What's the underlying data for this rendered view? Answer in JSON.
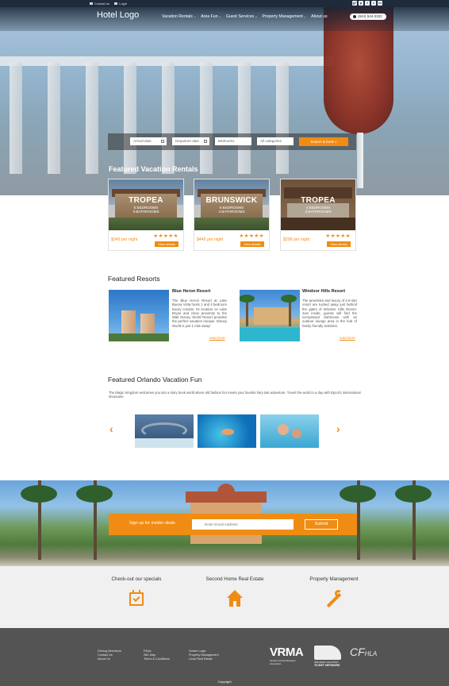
{
  "topbar": {
    "contact_label": "Contact us",
    "login_label": "Login",
    "social": [
      "g+",
      "p",
      "f",
      "t",
      "in"
    ]
  },
  "header": {
    "logo": "Hotel Logo",
    "menu": [
      "Vacation Rentals",
      "Area Fun",
      "Guest Services",
      "Property Management",
      "About us"
    ],
    "phone": "(844) 544-3322"
  },
  "search": {
    "arrival": "Arrival date",
    "departure": "Departure date",
    "bedrooms": "Bedrooms",
    "category": "All categories",
    "button": "Search & book"
  },
  "rentals": {
    "title": "Featured Vacation Rentals",
    "stars": "★★★★★",
    "view_label": "View details",
    "items": [
      {
        "name": "TROPEA",
        "beds": "5 BEDROOMS",
        "baths": "3 BATHROOMS",
        "price": "$349 per night"
      },
      {
        "name": "BRUNSWICK",
        "beds": "6 BEDROOMS",
        "baths": "4 BATHROOMS",
        "price": "$449 per night"
      },
      {
        "name": "TROPEA",
        "beds": "4 BEDROOMS",
        "baths": "3 BATHROOMS",
        "price": "$299 per night"
      }
    ]
  },
  "resorts": {
    "title": "Featured Resorts",
    "read_more": "read more",
    "items": [
      {
        "name": "Blue Heron Resort",
        "text": "The Blue Heron Resort at Lake Buena Vista hosts 1 and 2 bedroom luxury condos. Its location on Lake Bryan and close proximity to the Walt Disney World Resort provides the perfect vacation escape. Disney World is just 1 mile away!"
      },
      {
        "name": "Windsor Hills Resort",
        "text": "The amenities and luxury of a 5-star resort are tucked away just behind the gates of Windsor Hills Resort. Just inside, guests will find the exceptional clubhouse with an outdoor lounge area in the hub of family friendly activities."
      }
    ]
  },
  "fun": {
    "title": "Featured Orlando Vacation Fun",
    "text": "The Magic Kingdom welcomes you into a story book world where old fashion fun meets your favorite fairy tale adventure. Travel the world in a day with Epcot's international showcase.",
    "prev": "‹",
    "next": "›"
  },
  "signup": {
    "label": "Sign up for insider deals",
    "placeholder": "Enter Email Address",
    "submit": "Submit"
  },
  "services": [
    {
      "title": "Check-out our specials",
      "icon": "calendar-check-icon"
    },
    {
      "title": "Second Home Real Estate",
      "icon": "home-icon"
    },
    {
      "title": "Property Management",
      "icon": "wrench-icon"
    }
  ],
  "footer": {
    "col1": [
      "Driving Directions",
      "Contact Us",
      "About Us"
    ],
    "col2": [
      "FAQs",
      "Site Map",
      "Terms & Conditions"
    ],
    "col3": [
      "Owner Login",
      "Property Management",
      "Local Real Estate"
    ],
    "vrma": "VRMA",
    "vrma_sub": "Vacation Rental Managers Association",
    "ticket_top": "ORLANDO VACATION",
    "ticket_name": "TICKET NETWORK",
    "cfhla": "CF",
    "cfhla_small": "HLA",
    "copyright": "Copyright"
  },
  "colors": {
    "accent": "#f08c14",
    "nav": "#1f2a3a",
    "footer": "#545454",
    "services_bg": "#f0f0f0"
  }
}
